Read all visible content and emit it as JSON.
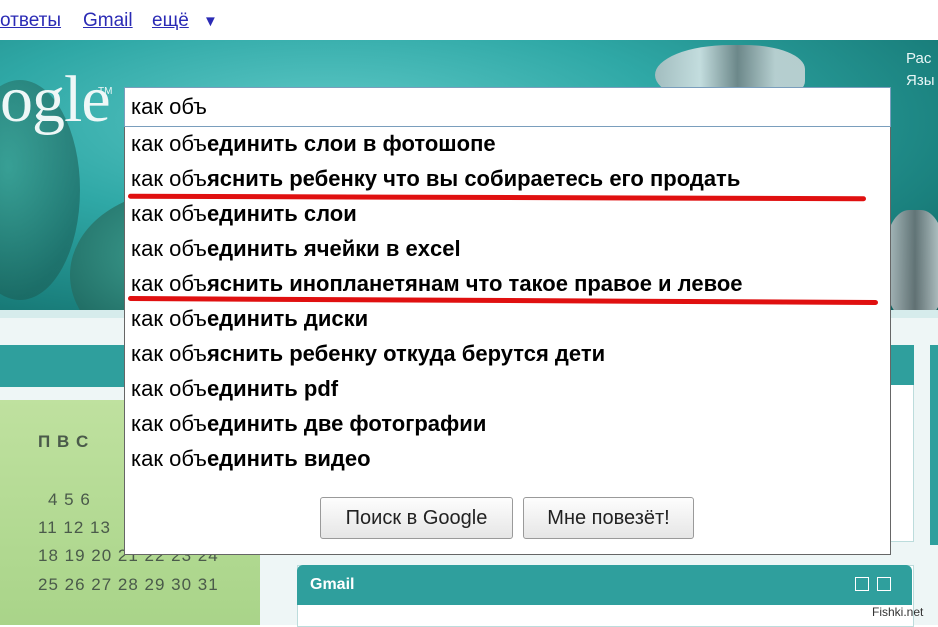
{
  "topnav": {
    "items": [
      "ответы",
      "Gmail",
      "ещё"
    ],
    "more_arrow": "▼"
  },
  "header": {
    "logo_text": "ogle",
    "logo_tm": "TM",
    "right_links": [
      "Рас",
      "Язы"
    ]
  },
  "search": {
    "value": "как объ",
    "suggestions": [
      {
        "prefix": "как объ",
        "rest": "единить слои в фотошопе"
      },
      {
        "prefix": "как объ",
        "rest": "яснить ребенку что вы собираетесь его продать"
      },
      {
        "prefix": "как объ",
        "rest": "единить слои"
      },
      {
        "prefix": "как объ",
        "rest": "единить ячейки в excel"
      },
      {
        "prefix": "как объ",
        "rest": "яснить инопланетянам что такое правое и левое"
      },
      {
        "prefix": "как объ",
        "rest": "единить диски"
      },
      {
        "prefix": "как объ",
        "rest": "яснить ребенку откуда берутся дети"
      },
      {
        "prefix": "как объ",
        "rest": "единить pdf"
      },
      {
        "prefix": "как объ",
        "rest": "единить две фотографии"
      },
      {
        "prefix": "как объ",
        "rest": "единить видео"
      }
    ],
    "buttons": {
      "search": "Поиск в Google",
      "lucky": "Мне повезёт!"
    },
    "highlight_color": "#e01010"
  },
  "calendar": {
    "days_header": "П  В  С",
    "rows": [
      "4  5  6",
      "11 12 13",
      "18 19 20 21 22 23 24",
      "25 26 27 28 29 30 31"
    ]
  },
  "widgets": {
    "gmail_title": "Gmail"
  },
  "watermark": "Fishki.net",
  "colors": {
    "teal": "#2f9f9d",
    "link": "#2b2bb5"
  }
}
